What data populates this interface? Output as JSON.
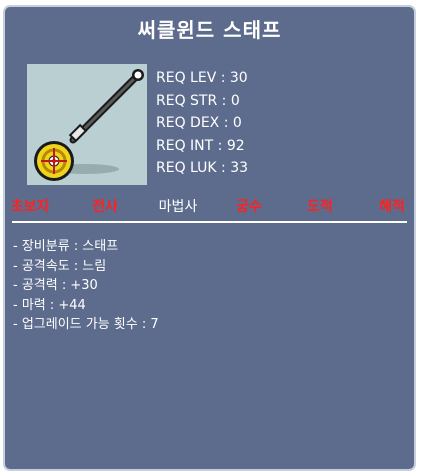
{
  "item": {
    "name": "써클윈드 스태프",
    "icon": "staff-icon"
  },
  "requirements": [
    "REQ LEV : 30",
    "REQ STR : 0",
    "REQ DEX : 0",
    "REQ INT : 92",
    "REQ LUK : 33"
  ],
  "jobs": [
    {
      "label": "초보자",
      "allowed": false
    },
    {
      "label": "전사",
      "allowed": false
    },
    {
      "label": "마법사",
      "allowed": true
    },
    {
      "label": "궁수",
      "allowed": false
    },
    {
      "label": "도적",
      "allowed": false
    },
    {
      "label": "해적",
      "allowed": false
    }
  ],
  "stats": [
    "- 장비분류 : 스태프",
    "- 공격속도 : 느림",
    "- 공격력 : +30",
    "- 마력 : +44",
    "- 업그레이드 가능 횟수 : 7"
  ],
  "colors": {
    "panel": "#5d6b8d",
    "restricted_job": "#ff2020",
    "allowed_job": "#ffffff"
  }
}
